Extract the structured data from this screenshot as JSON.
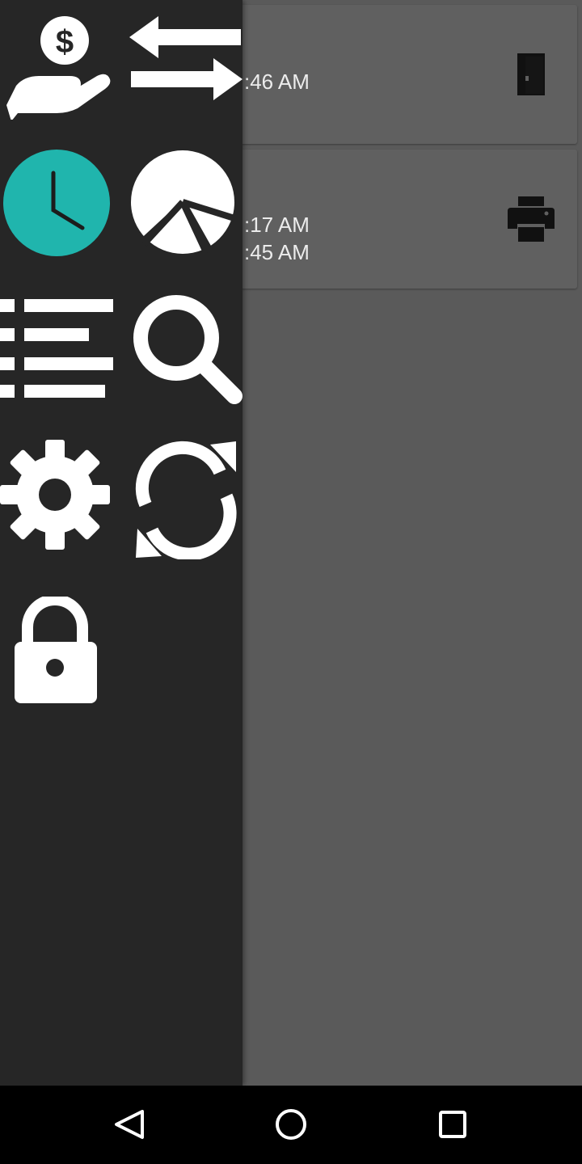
{
  "list": {
    "card1": {
      "time1": ":46 AM",
      "icon": "door-icon"
    },
    "card2": {
      "time1": ":17 AM",
      "time2": ":45 AM",
      "icon": "printer-icon"
    }
  },
  "drawer": {
    "icons": [
      "hand-money-icon",
      "transfer-arrows-icon",
      "clock-icon",
      "pie-chart-icon",
      "list-icon",
      "search-icon",
      "settings-gear-icon",
      "sync-icon",
      "lock-icon"
    ],
    "accent_color": "#20b5ad"
  },
  "navbar": {
    "icons": [
      "back-icon",
      "home-icon",
      "recents-icon"
    ]
  }
}
